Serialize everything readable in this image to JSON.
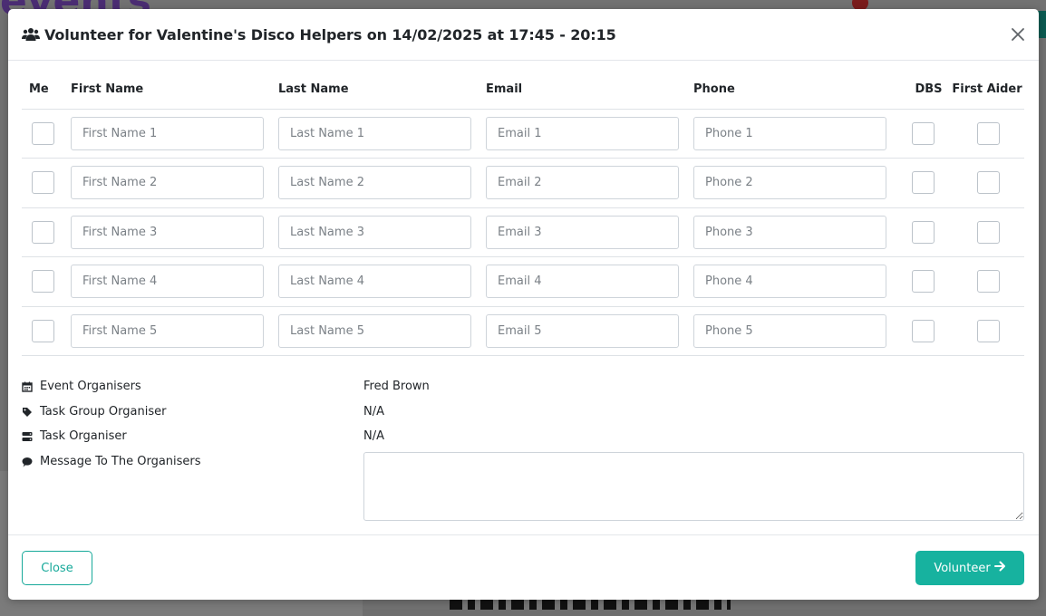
{
  "background": {
    "logo_text": "events"
  },
  "modal": {
    "title": "Volunteer for Valentine's Disco Helpers on 14/02/2025 at 17:45 - 20:15",
    "title_icon": "users-icon",
    "close_icon": "close-icon",
    "columns": [
      "Me",
      "First Name",
      "Last Name",
      "Email",
      "Phone",
      "DBS",
      "First Aider"
    ],
    "rows": [
      {
        "first_name_placeholder": "First Name 1",
        "last_name_placeholder": "Last Name 1",
        "email_placeholder": "Email 1",
        "phone_placeholder": "Phone 1"
      },
      {
        "first_name_placeholder": "First Name 2",
        "last_name_placeholder": "Last Name 2",
        "email_placeholder": "Email 2",
        "phone_placeholder": "Phone 2"
      },
      {
        "first_name_placeholder": "First Name 3",
        "last_name_placeholder": "Last Name 3",
        "email_placeholder": "Email 3",
        "phone_placeholder": "Phone 3"
      },
      {
        "first_name_placeholder": "First Name 4",
        "last_name_placeholder": "Last Name 4",
        "email_placeholder": "Email 4",
        "phone_placeholder": "Phone 4"
      },
      {
        "first_name_placeholder": "First Name 5",
        "last_name_placeholder": "Last Name 5",
        "email_placeholder": "Email 5",
        "phone_placeholder": "Phone 5"
      }
    ],
    "info": {
      "event_organisers_label": "Event Organisers",
      "event_organisers_value": "Fred Brown",
      "task_group_organiser_label": "Task Group Organiser",
      "task_group_organiser_value": "N/A",
      "task_organiser_label": "Task Organiser",
      "task_organiser_value": "N/A",
      "message_label": "Message To The Organisers",
      "message_value": ""
    },
    "footer": {
      "close_label": "Close",
      "volunteer_label": "Volunteer"
    }
  },
  "colors": {
    "accent": "#17b29f",
    "overlay": "#727272"
  }
}
